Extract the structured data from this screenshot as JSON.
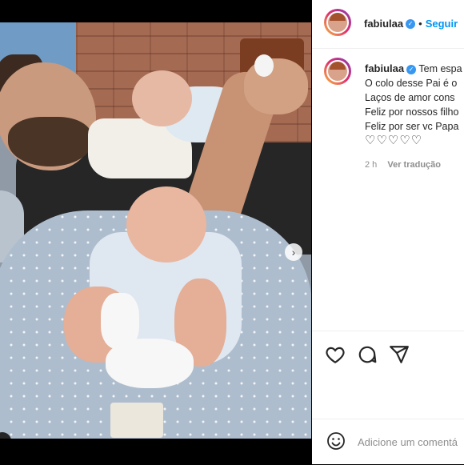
{
  "post": {
    "author": "fabiulaa",
    "follow_label": "Seguir",
    "caption_lines": [
      "Tem espa",
      "O colo desse Pai é o",
      "Laços de amor cons",
      "Feliz por nossos filho",
      "Feliz por ser vc Papa",
      "♡♡♡♡♡"
    ],
    "time": "2 h",
    "see_translation": "Ver tradução"
  },
  "comment": {
    "placeholder": "Adicione um comentá"
  },
  "icons": {
    "next": "›",
    "user_tag": "●",
    "verified": "✓"
  },
  "colors": {
    "accent": "#0095f6",
    "verified": "#3897f0"
  }
}
